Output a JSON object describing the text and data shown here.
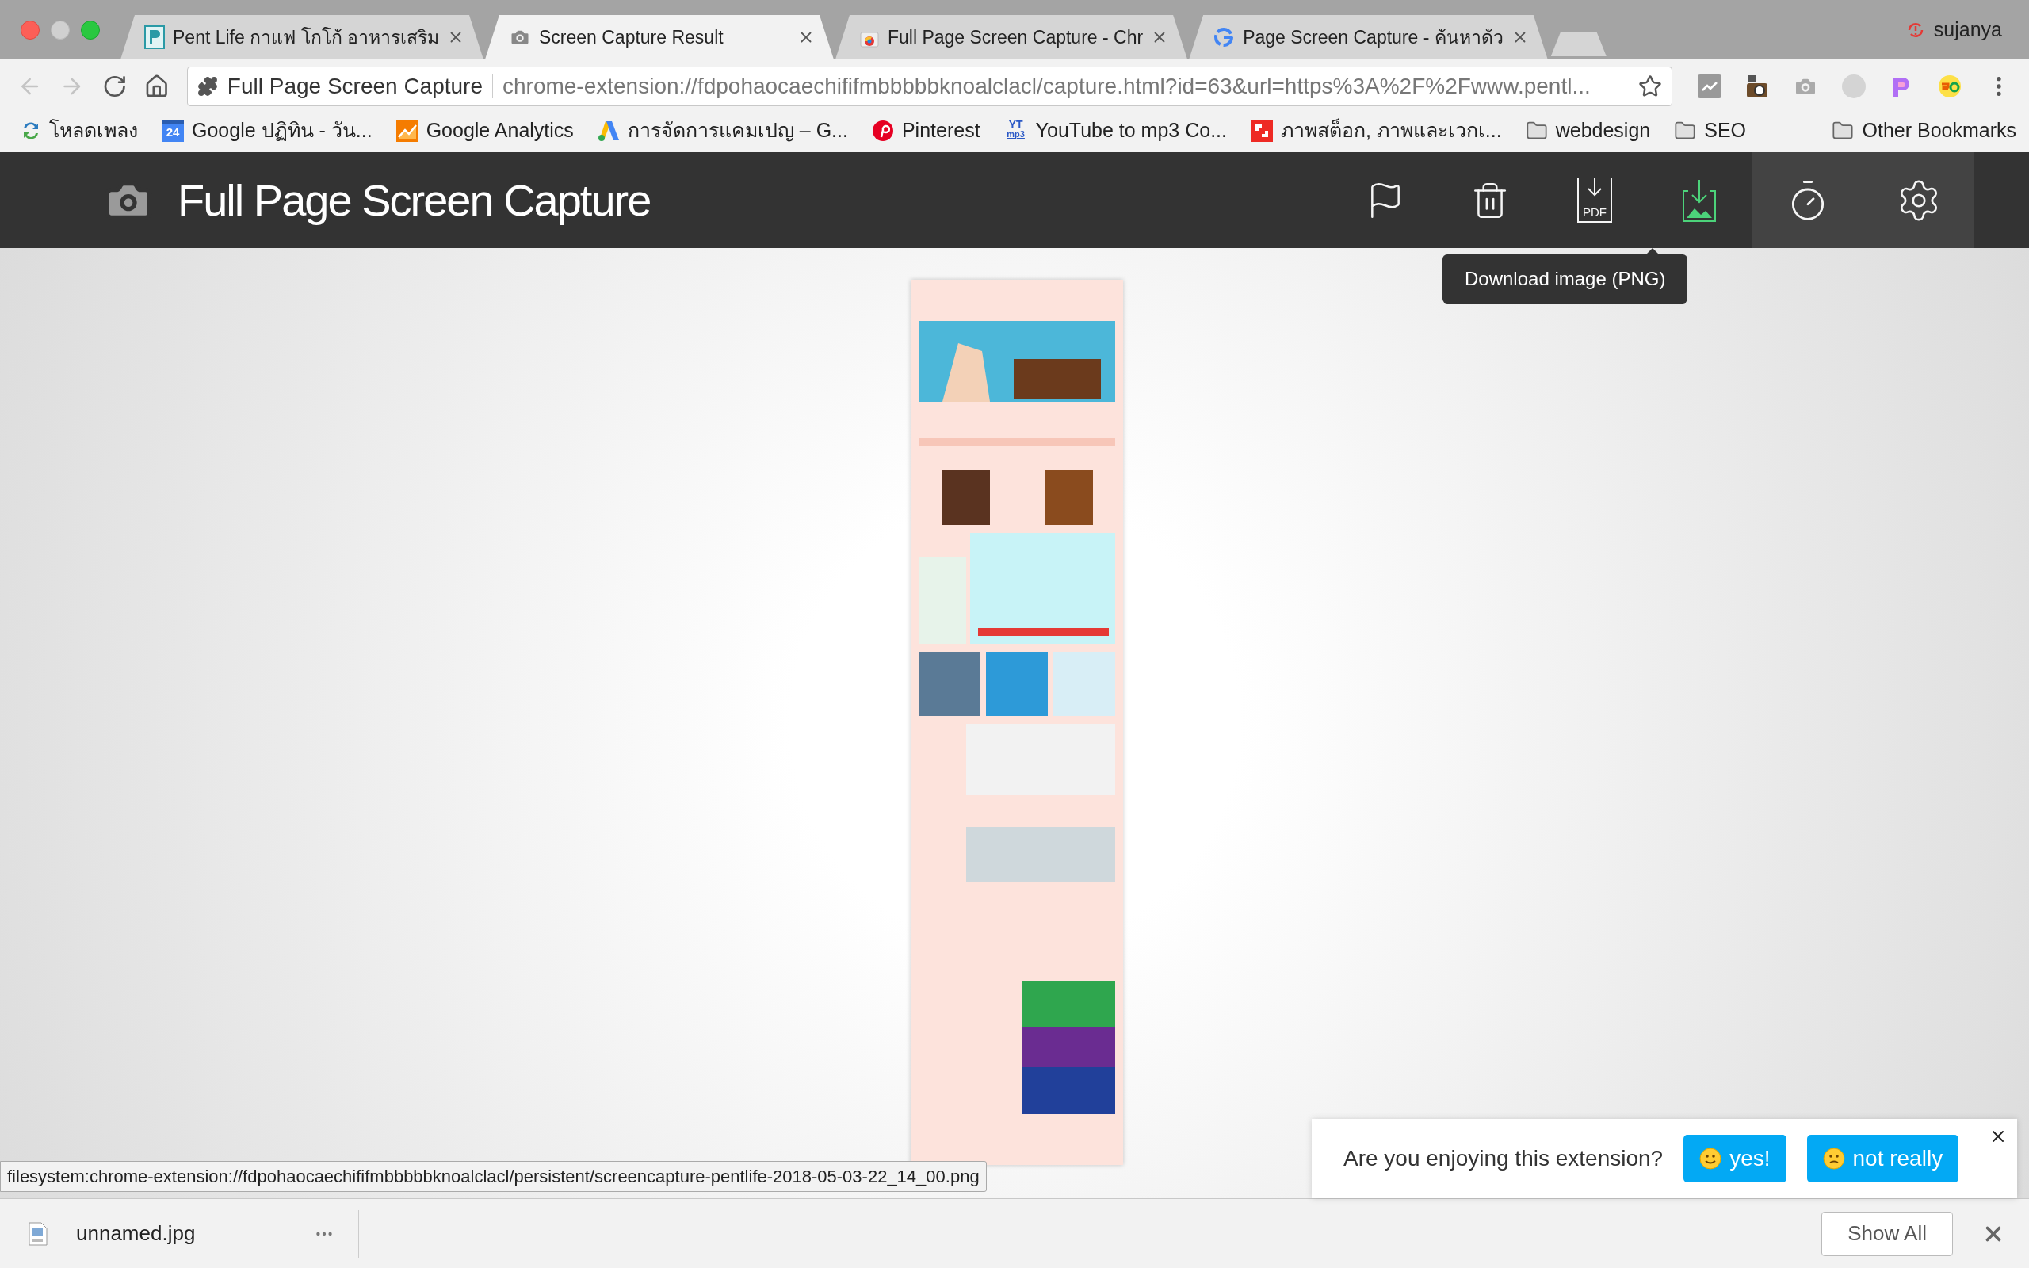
{
  "tabs": [
    {
      "title": "Pent Life กาแฟ โกโก้ อาหารเสริม",
      "kind": "site",
      "selected": false
    },
    {
      "title": "Screen Capture Result",
      "kind": "camera",
      "selected": true
    },
    {
      "title": "Full Page Screen Capture - Chr",
      "kind": "store",
      "selected": false
    },
    {
      "title": "Page Screen Capture - ค้นหาด้ว",
      "kind": "google",
      "selected": false
    }
  ],
  "profile": "sujanya",
  "omnibox": {
    "site_label": "Full Page Screen Capture",
    "url": "chrome-extension://fdpohaocaechififmbbbbbknoalclacl/capture.html?id=63&url=https%3A%2F%2Fwww.pentl..."
  },
  "bookmarks": [
    {
      "label": "โหลดเพลง",
      "kind": "sync"
    },
    {
      "label": "Google ปฏิทิน - วัน...",
      "kind": "calendar",
      "badge": "24"
    },
    {
      "label": "Google Analytics",
      "kind": "analytics"
    },
    {
      "label": "การจัดการแคมเปญ – G...",
      "kind": "ads"
    },
    {
      "label": "Pinterest",
      "kind": "pinterest"
    },
    {
      "label": "YouTube to mp3 Co...",
      "kind": "yt",
      "badge": "YT",
      "badge_sub": "mp3"
    },
    {
      "label": "ภาพสต็อก, ภาพและเวกเ...",
      "kind": "stock"
    },
    {
      "label": "webdesign",
      "kind": "folder"
    },
    {
      "label": "SEO",
      "kind": "folder"
    }
  ],
  "other_bookmarks": "Other Bookmarks",
  "app": {
    "title": "Full Page Screen Capture",
    "actions": [
      {
        "kind": "flag",
        "active": false
      },
      {
        "kind": "trash",
        "active": false
      },
      {
        "kind": "pdf",
        "label": "PDF",
        "active": false
      },
      {
        "kind": "png",
        "active": true
      },
      {
        "kind": "timer",
        "active": false
      },
      {
        "kind": "settings",
        "active": false
      }
    ],
    "tooltip": "Download image (PNG)"
  },
  "status_url": "filesystem:chrome-extension://fdpohaocaechififmbbbbbknoalclacl/persistent/screencapture-pentlife-2018-05-03-22_14_00.png",
  "feedback": {
    "question": "Are you enjoying this extension?",
    "buttons": [
      {
        "label": "yes!",
        "kind": "happy"
      },
      {
        "label": "not really",
        "kind": "unsure"
      }
    ]
  },
  "downloads": {
    "items": [
      {
        "name": "unnamed.jpg"
      }
    ],
    "show_all": "Show All"
  }
}
